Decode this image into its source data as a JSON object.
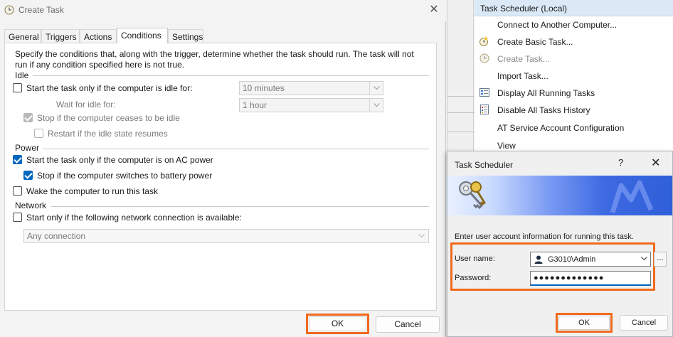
{
  "create_task": {
    "title": "Create Task",
    "tabs": [
      "General",
      "Triggers",
      "Actions",
      "Conditions",
      "Settings"
    ],
    "active_tab": "Conditions",
    "description": "Specify the conditions that, along with the trigger, determine whether the task should run.  The task will not run  if any condition specified here is not true.",
    "idle": {
      "group_label": "Idle",
      "start_if_idle": "Start the task only if the computer is idle for:",
      "idle_for_value": "10 minutes",
      "wait_label": "Wait for idle for:",
      "wait_value": "1 hour",
      "stop_if_ceases": "Stop if the computer ceases to be idle",
      "restart_if_resumes": "Restart if the idle state resumes"
    },
    "power": {
      "group_label": "Power",
      "start_on_ac": "Start the task only if the computer is on AC power",
      "stop_on_battery": "Stop if the computer switches to battery power",
      "wake": "Wake the computer to run this task"
    },
    "network": {
      "group_label": "Network",
      "start_if_network": "Start only if the following network connection is available:",
      "connection_value": "Any connection"
    },
    "ok_label": "OK",
    "cancel_label": "Cancel"
  },
  "actions_pane": {
    "header": "Task Scheduler (Local)",
    "items": [
      {
        "label": "Connect to Another Computer...",
        "icon": "none"
      },
      {
        "label": "Create Basic Task...",
        "icon": "create-basic-task-icon"
      },
      {
        "label": "Create Task...",
        "icon": "create-task-icon"
      },
      {
        "label": "Import Task...",
        "icon": "none"
      },
      {
        "label": "Display All Running Tasks",
        "icon": "running-tasks-icon"
      },
      {
        "label": "Disable All Tasks History",
        "icon": "history-icon"
      },
      {
        "label": "AT Service Account Configuration",
        "icon": "none"
      },
      {
        "label": "View",
        "icon": "none"
      }
    ]
  },
  "credentials_dialog": {
    "title": "Task Scheduler",
    "help": "?",
    "info": "Enter user account information for running this task.",
    "username_label": "User name:",
    "username_value": "G3010\\Admin",
    "password_label": "Password:",
    "password_value": "●●●●●●●●●●●●●",
    "browse_label": "...",
    "ok_label": "OK",
    "cancel_label": "Cancel"
  },
  "colors": {
    "highlight": "#f06a1e",
    "accent": "#0067c0",
    "actions_header": "#dbe9f7"
  }
}
